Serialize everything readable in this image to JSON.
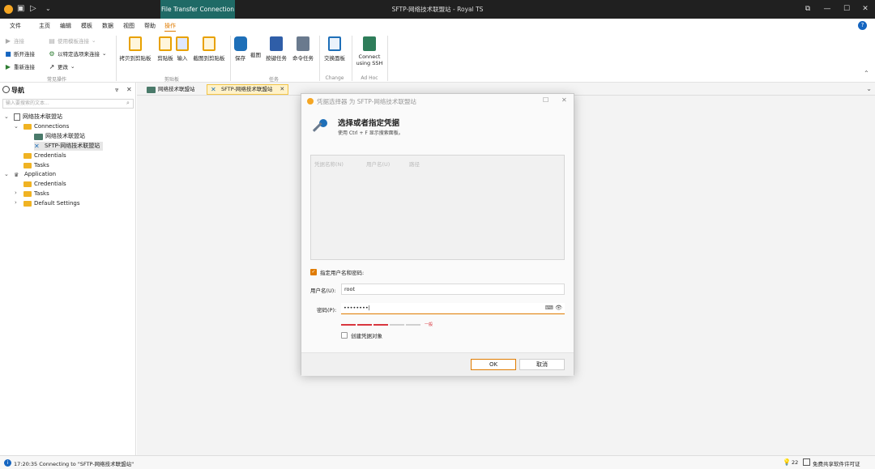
{
  "titlebar": {
    "context_tab": "File Transfer Connection",
    "title": "SFTP-网络技术联盟站 - Royal TS",
    "controls": [
      "⧉",
      "—",
      "☐",
      "✕"
    ]
  },
  "menu": {
    "items": [
      "文件",
      "主页",
      "编辑",
      "模板",
      "数据",
      "视图",
      "帮助",
      "操作"
    ],
    "active_index": 7,
    "help": "?"
  },
  "ribbon": {
    "common": {
      "connect": "连接",
      "disconnect": "断开连接",
      "reconnect": "重新连接",
      "template_connect": "使用模板连接",
      "options_connect": "以特定选项来连接",
      "change": "更改",
      "group_label": "常见操作"
    },
    "clipboard": {
      "copy_to_clipboard": "拷贝到剪贴板",
      "clipboard": "剪贴板",
      "input": "输入",
      "screenshot_to_clipboard": "截图到剪贴板",
      "group_label": "剪贴板"
    },
    "tasks": {
      "save": "保存",
      "screenshot": "截图",
      "key_task": "按键任务",
      "command_task": "命令任务",
      "group_label": "任务"
    },
    "change": {
      "swap_panel": "交换面板",
      "group_label": "Change"
    },
    "adhoc": {
      "connect_ssh": "Connect using SSH",
      "connect_ssh_line1": "Connect",
      "connect_ssh_line2": "using SSH",
      "group_label": "Ad Hoc"
    }
  },
  "nav": {
    "title": "导航",
    "search_placeholder": "输入要搜索的文本...",
    "tree": [
      {
        "label": "网络技术联盟站",
        "level": 0,
        "expanded": true,
        "icon": "document-icon"
      },
      {
        "label": "Connections",
        "level": 1,
        "expanded": true,
        "icon": "folder-icon"
      },
      {
        "label": "网络技术联盟站",
        "level": 2,
        "icon": "terminal-icon"
      },
      {
        "label": "SFTP-网络技术联盟站",
        "level": 2,
        "icon": "sftp-icon",
        "selected": true
      },
      {
        "label": "Credentials",
        "level": 1,
        "icon": "folder-icon"
      },
      {
        "label": "Tasks",
        "level": 1,
        "icon": "folder-icon"
      },
      {
        "label": "Application",
        "level": 0,
        "expanded": true,
        "icon": "application-icon"
      },
      {
        "label": "Credentials",
        "level": 1,
        "icon": "folder-icon"
      },
      {
        "label": "Tasks",
        "level": 1,
        "collapsed": true,
        "icon": "folder-icon"
      },
      {
        "label": "Default Settings",
        "level": 1,
        "collapsed": true,
        "icon": "folder-icon"
      }
    ]
  },
  "tabs": [
    {
      "label": "网络技术联盟站",
      "active": false
    },
    {
      "label": "SFTP-网络技术联盟站",
      "active": true
    }
  ],
  "dialog": {
    "title": "凭据选择器 为 SFTP-网络技术联盟站",
    "heading": "选择或者指定凭据",
    "subtext": "使用 Ctrl + F 显示搜索面板。",
    "columns": [
      "凭据名称(N)",
      "用户名(U)",
      "路径"
    ],
    "specify_checkbox": "指定用户名和密码:",
    "specify_checked": true,
    "username_label": "用户名(U):",
    "username_value": "root",
    "password_label": "密码(P):",
    "password_value": "••••••••",
    "strength_text": "一般",
    "strength_level": 3,
    "strength_segments": 5,
    "create_checkbox": "创建凭据对象",
    "create_checked": false,
    "ok": "OK",
    "cancel": "取消"
  },
  "status": {
    "message": "17:20:35 Connecting to \"SFTP-网络技术联盟站\"",
    "count": "22",
    "license": "免费共享软件许可证"
  },
  "colors": {
    "accent": "#e07b00",
    "titlebar": "#202020",
    "context_tab": "#1f6a66",
    "strength_weak": "#d9363e"
  }
}
